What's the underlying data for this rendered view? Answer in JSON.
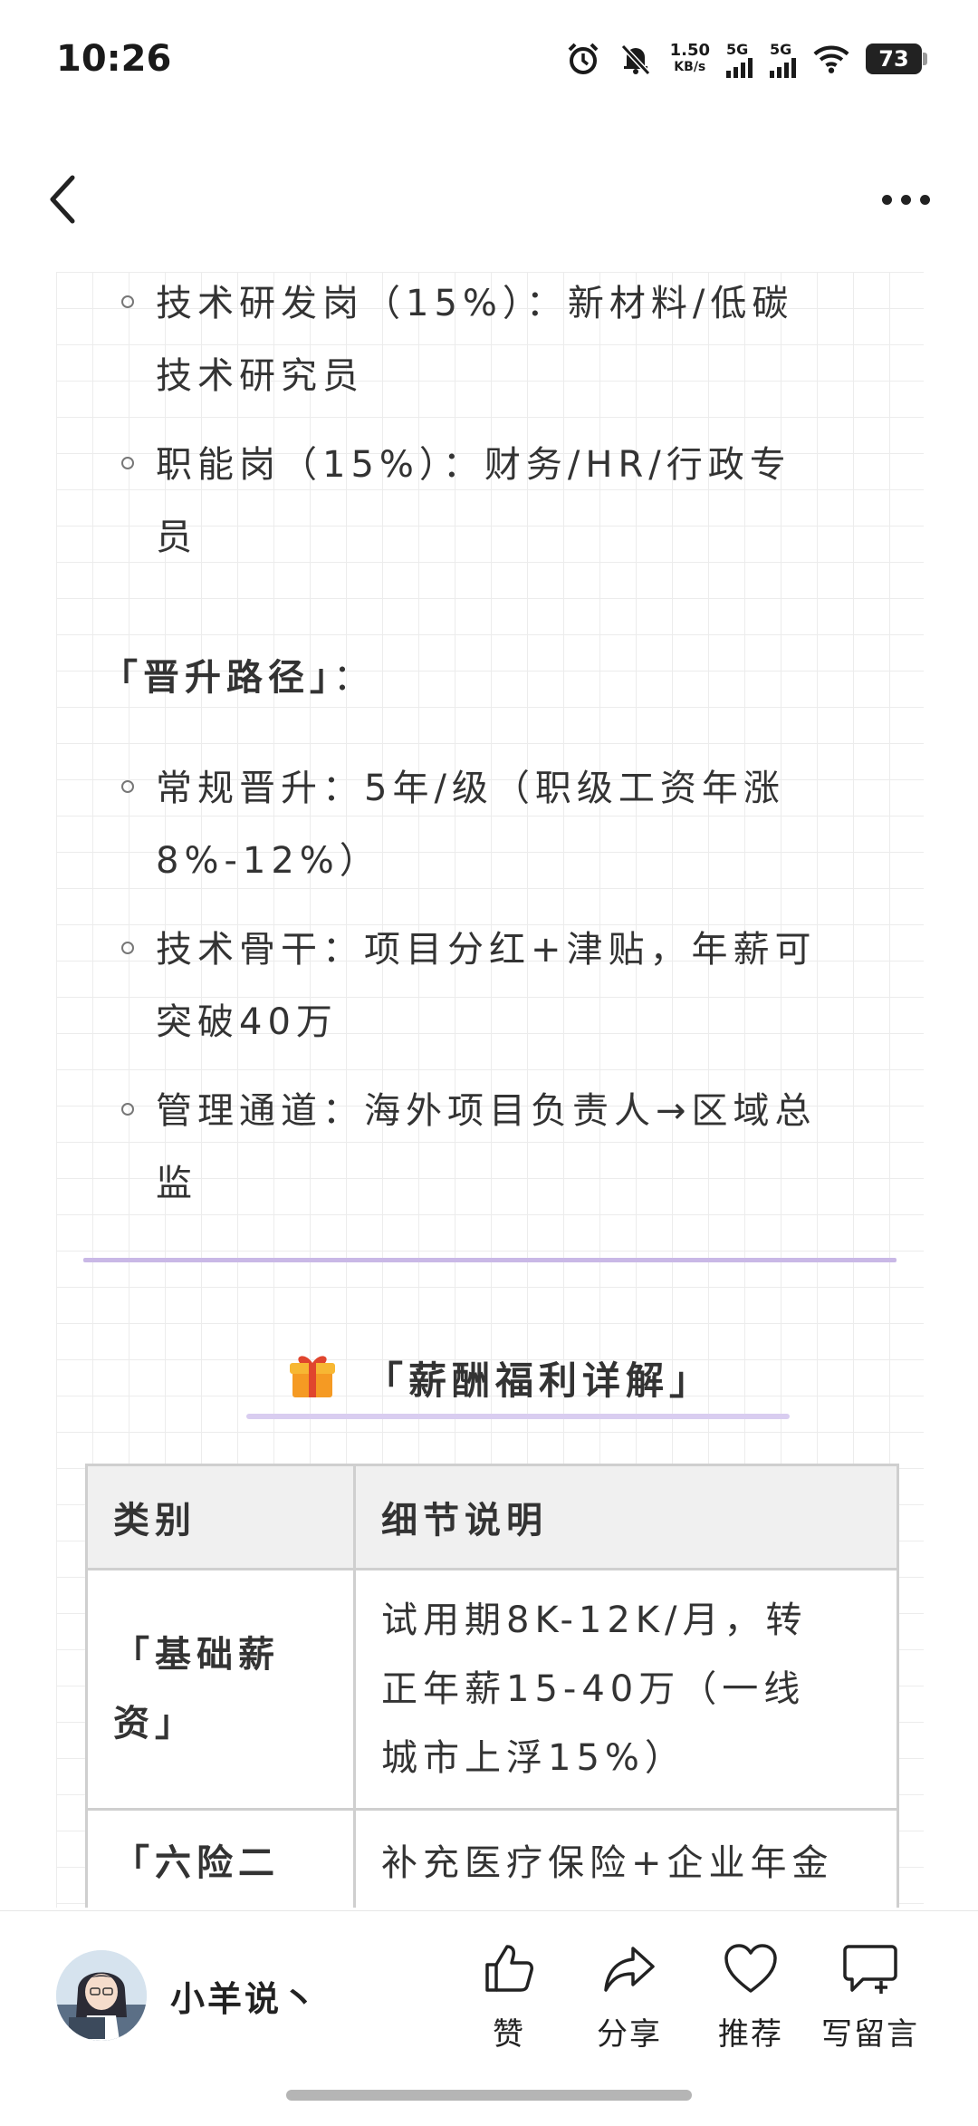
{
  "status_bar": {
    "time": "10:26",
    "net_speed_value": "1.50",
    "net_speed_unit": "KB/s",
    "sim1": "5G",
    "sim2": "5G",
    "battery": "73"
  },
  "article": {
    "job_items": [
      {
        "line1": "技术研发岗（15%）：新材料/低碳",
        "line2": "技术研究员"
      },
      {
        "line1": "职能岗（15%）：财务/HR/行政专",
        "line2": "员"
      }
    ],
    "promotion_heading": "「晋升路径」",
    "promotion_colon": "：",
    "promotion_items": [
      {
        "line1": "常规晋升：5年/级（职级工资年涨",
        "line2": "8%-12%）"
      },
      {
        "line1": "技术骨干：项目分红+津贴，年薪可",
        "line2": "突破40万"
      },
      {
        "line1": "管理通道：海外项目负责人→区域总",
        "line2": "监"
      }
    ],
    "section_title": "「薪酬福利详解」",
    "table": {
      "headers": [
        "类别",
        "细节说明"
      ],
      "rows": [
        {
          "category_line1": "「基础薪",
          "category_line2": "资」",
          "detail_line1": "试用期8K-12K/月，转",
          "detail_line2": "正年薪15-40万（一线",
          "detail_line3": "城市上浮15%）"
        },
        {
          "category_line1": "「六险二",
          "detail_line1": "补充医疗保险+企业年金"
        }
      ]
    }
  },
  "bottom_bar": {
    "author": "小羊说丶",
    "actions": {
      "like": "赞",
      "share": "分享",
      "recommend": "推荐",
      "comment": "写留言"
    }
  },
  "colors": {
    "divider": "#c9b8e6",
    "title_underline": "#d9cdf0",
    "table_header_bg": "#f0f0f0"
  },
  "icons": [
    "alarm-icon",
    "mute-bell-icon",
    "signal-icon",
    "wifi-icon",
    "battery-icon",
    "back-arrow-icon",
    "more-icon",
    "gift-icon",
    "thumbs-up-icon",
    "share-arrow-icon",
    "heart-icon",
    "comment-plus-icon"
  ]
}
